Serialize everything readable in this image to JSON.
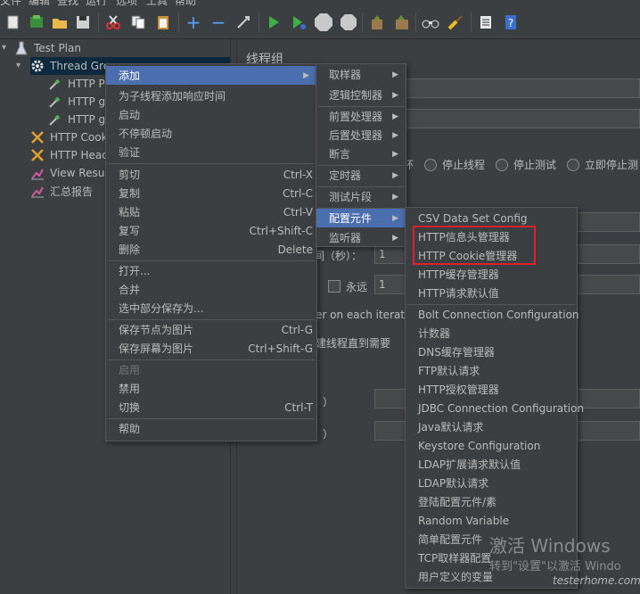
{
  "menubar": [
    "文件",
    "编辑",
    "查找",
    "运行",
    "选项",
    "工具",
    "帮助"
  ],
  "toolbar": [
    {
      "icon": "new-icon"
    },
    {
      "icon": "templates-icon"
    },
    {
      "icon": "open-icon"
    },
    {
      "icon": "save-icon"
    },
    {
      "icon": "cut-icon"
    },
    {
      "icon": "copy-icon"
    },
    {
      "icon": "paste-icon"
    },
    {
      "icon": "expand-icon"
    },
    {
      "icon": "collapse-icon"
    },
    {
      "icon": "toggle-icon"
    },
    {
      "icon": "start-icon"
    },
    {
      "icon": "start-no-pause-icon"
    },
    {
      "icon": "stop-icon"
    },
    {
      "icon": "shutdown-icon"
    },
    {
      "icon": "clear-icon"
    },
    {
      "icon": "clear-all-icon"
    },
    {
      "icon": "search-icon"
    },
    {
      "icon": "reset-search-icon"
    },
    {
      "icon": "function-helper-icon"
    },
    {
      "icon": "help-icon"
    }
  ],
  "tree": {
    "items": [
      {
        "label": "Test Plan",
        "icon": "test-plan-icon"
      },
      {
        "label": "Thread Gro",
        "icon": "thread-group-gear-icon"
      },
      {
        "label": "HTTP P",
        "icon": "pipette-icon"
      },
      {
        "label": "HTTP g",
        "icon": "pipette-icon"
      },
      {
        "label": "HTTP g",
        "icon": "pipette-icon"
      },
      {
        "label": "HTTP Cook",
        "icon": "wrench-icon"
      },
      {
        "label": "HTTP Head",
        "icon": "wrench-icon"
      },
      {
        "label": "View Result",
        "icon": "chart-icon"
      },
      {
        "label": "汇总报告",
        "icon": "chart-icon"
      }
    ]
  },
  "right": {
    "title": "线程组",
    "error_action_tail": "环",
    "radios": [
      "停止线程",
      "停止测试",
      "立即停止测"
    ],
    "loop_label": "间（秒）：",
    "ramp_value": "1",
    "forever_label": "永远",
    "loop_value": "1",
    "iteration_text": "er on each iteratio",
    "delay_text": "建线程直到需要",
    "duration_paren": "）",
    "delay_paren": "）"
  },
  "context_menu": {
    "items": [
      {
        "label": "添加",
        "shortcut": "",
        "submenu": true,
        "highlighted": true
      },
      {
        "label": "为子线程添加响应时间",
        "shortcut": ""
      },
      {
        "label": "启动",
        "shortcut": ""
      },
      {
        "label": "不停顿启动",
        "shortcut": ""
      },
      {
        "label": "验证",
        "shortcut": ""
      },
      {
        "label": "剪切",
        "shortcut": "Ctrl-X"
      },
      {
        "label": "复制",
        "shortcut": "Ctrl-C"
      },
      {
        "label": "粘贴",
        "shortcut": "Ctrl-V"
      },
      {
        "label": "复写",
        "shortcut": "Ctrl+Shift-C"
      },
      {
        "label": "删除",
        "shortcut": "Delete"
      },
      {
        "label": "打开...",
        "shortcut": ""
      },
      {
        "label": "合并",
        "shortcut": ""
      },
      {
        "label": "选中部分保存为...",
        "shortcut": ""
      },
      {
        "label": "保存节点为图片",
        "shortcut": "Ctrl-G"
      },
      {
        "label": "保存屏幕为图片",
        "shortcut": "Ctrl+Shift-G"
      },
      {
        "label": "启用",
        "shortcut": "",
        "disabled": true
      },
      {
        "label": "禁用",
        "shortcut": ""
      },
      {
        "label": "切换",
        "shortcut": "Ctrl-T"
      },
      {
        "label": "帮助",
        "shortcut": ""
      }
    ]
  },
  "add_submenu": {
    "items": [
      {
        "label": "取样器"
      },
      {
        "label": "逻辑控制器"
      },
      {
        "label": "前置处理器"
      },
      {
        "label": "后置处理器"
      },
      {
        "label": "断言"
      },
      {
        "label": "定时器"
      },
      {
        "label": "测试片段"
      },
      {
        "label": "配置元件",
        "highlighted": true
      },
      {
        "label": "监听器"
      }
    ]
  },
  "config_submenu": {
    "items": [
      {
        "label": "CSV Data Set Config"
      },
      {
        "label": "HTTP信息头管理器"
      },
      {
        "label": "HTTP Cookie管理器"
      },
      {
        "label": "HTTP缓存管理器"
      },
      {
        "label": "HTTP请求默认值"
      },
      {
        "label": "Bolt Connection Configuration"
      },
      {
        "label": "计数器"
      },
      {
        "label": "DNS缓存管理器"
      },
      {
        "label": "FTP默认请求"
      },
      {
        "label": "HTTP授权管理器"
      },
      {
        "label": "JDBC Connection Configuration"
      },
      {
        "label": "Java默认请求"
      },
      {
        "label": "Keystore Configuration"
      },
      {
        "label": "LDAP扩展请求默认值"
      },
      {
        "label": "LDAP默认请求"
      },
      {
        "label": "登陆配置元件/素"
      },
      {
        "label": "Random Variable"
      },
      {
        "label": "简单配置元件"
      },
      {
        "label": "TCP取样器配置"
      },
      {
        "label": "用户定义的变量"
      }
    ]
  },
  "watermark": {
    "line1": "激活 Windows",
    "line2": "转到\"设置\"以激活 Windo",
    "site": "testerhome.com"
  },
  "colors": {
    "background": "#3c3f41",
    "highlight": "#4b6eaf",
    "selected_tree": "#0d293e",
    "annotation": "#e0202a"
  }
}
